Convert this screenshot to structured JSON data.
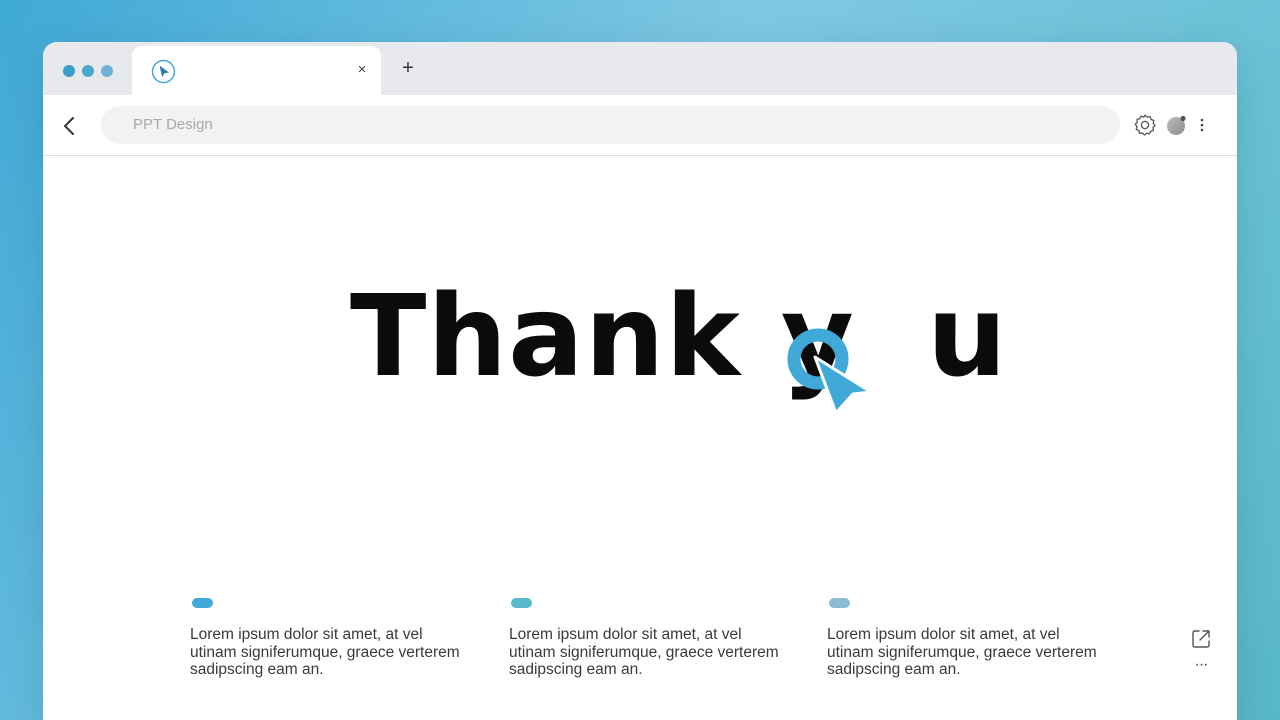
{
  "window": {
    "window_dot_colors": [
      "#3a9fc9",
      "#4aa8cf",
      "#6eb3d6"
    ],
    "tab": {
      "title": "",
      "favicon": "cursor-icon",
      "close_label": "×"
    },
    "new_tab_label": "+"
  },
  "toolbar": {
    "address": {
      "value": "PPT Design"
    },
    "icons": [
      "back-icon",
      "gear-icon",
      "profile-icon",
      "more-vertical-icon"
    ]
  },
  "slide": {
    "headline_before": "Thank y",
    "headline_after": "u",
    "headline_o_graphic": "cursor-o-icon",
    "accent_color": "#41a9d8",
    "columns": [
      {
        "pill_color": "#41a9d8",
        "text": "Lorem ipsum dolor sit amet, at vel utinam signiferumque, graece verterem sadipscing eam an."
      },
      {
        "pill_color": "#58b9cd",
        "text": "Lorem ipsum dolor sit amet, at vel utinam signiferumque, graece verterem sadipscing eam an."
      },
      {
        "pill_color": "#8bbcd6",
        "text": "Lorem ipsum dolor sit amet, at vel utinam signiferumque, graece verterem sadipscing eam an."
      }
    ]
  },
  "side_actions": {
    "share_icon": "external-link-icon",
    "more_label": "···"
  }
}
